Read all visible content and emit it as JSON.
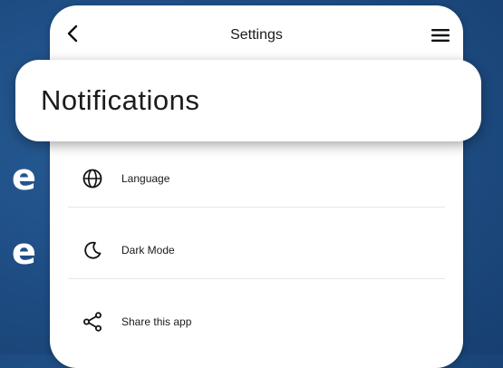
{
  "background": {
    "text_fragments": [
      "e",
      "e"
    ]
  },
  "header": {
    "title": "Settings",
    "back_icon": "chevron-left-icon",
    "menu_icon": "hamburger-menu-icon"
  },
  "highlighted_item": {
    "label": "Notifications"
  },
  "items": [
    {
      "label": "Language",
      "icon": "globe-icon"
    },
    {
      "label": "Dark Mode",
      "icon": "moon-icon"
    },
    {
      "label": "Share this app",
      "icon": "share-icon"
    }
  ],
  "colors": {
    "background": "#1f4f86",
    "card": "#ffffff",
    "text": "#1a1a1a"
  }
}
